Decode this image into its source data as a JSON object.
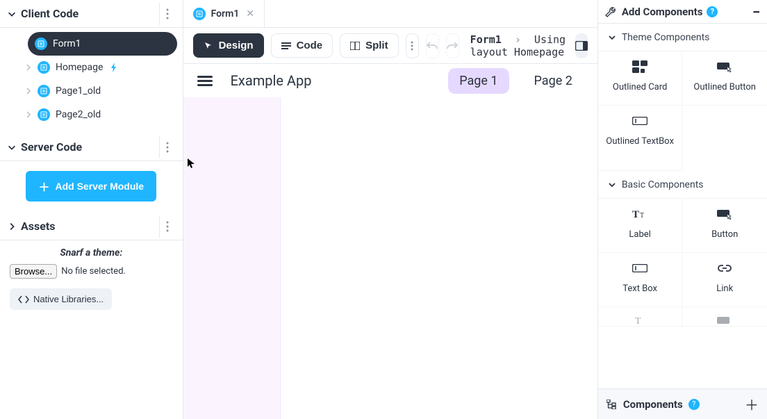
{
  "sidebar": {
    "sections": {
      "client": "Client Code",
      "server": "Server Code",
      "assets": "Assets"
    },
    "client_items": [
      {
        "label": "Form1",
        "active": true
      },
      {
        "label": "Homepage",
        "startup": true
      },
      {
        "label": "Page1_old"
      },
      {
        "label": "Page2_old"
      }
    ],
    "add_server_label": "Add Server Module",
    "snarf_label": "Snarf a theme:",
    "browse_label": "Browse...",
    "no_file_label": "No file selected.",
    "native_label": "Native Libraries..."
  },
  "tabs": {
    "open": [
      {
        "label": "Form1"
      }
    ]
  },
  "toolbar": {
    "design": "Design",
    "code": "Code",
    "split": "Split",
    "breadcrumb_form": "Form1",
    "breadcrumb_layout": "Using layout Homepage"
  },
  "canvas": {
    "app_title": "Example App",
    "pages": [
      {
        "label": "Page 1",
        "active": true
      },
      {
        "label": "Page 2"
      }
    ]
  },
  "right": {
    "panel_title": "Add Components",
    "help": "?",
    "sections": {
      "theme": "Theme Components",
      "basic": "Basic Components"
    },
    "theme_items": [
      {
        "label": "Outlined Card"
      },
      {
        "label": "Outlined Button"
      },
      {
        "label": "Outlined TextBox"
      }
    ],
    "basic_items": [
      {
        "label": "Label"
      },
      {
        "label": "Button"
      },
      {
        "label": "Text Box"
      },
      {
        "label": "Link"
      }
    ],
    "bottom_title": "Components"
  }
}
